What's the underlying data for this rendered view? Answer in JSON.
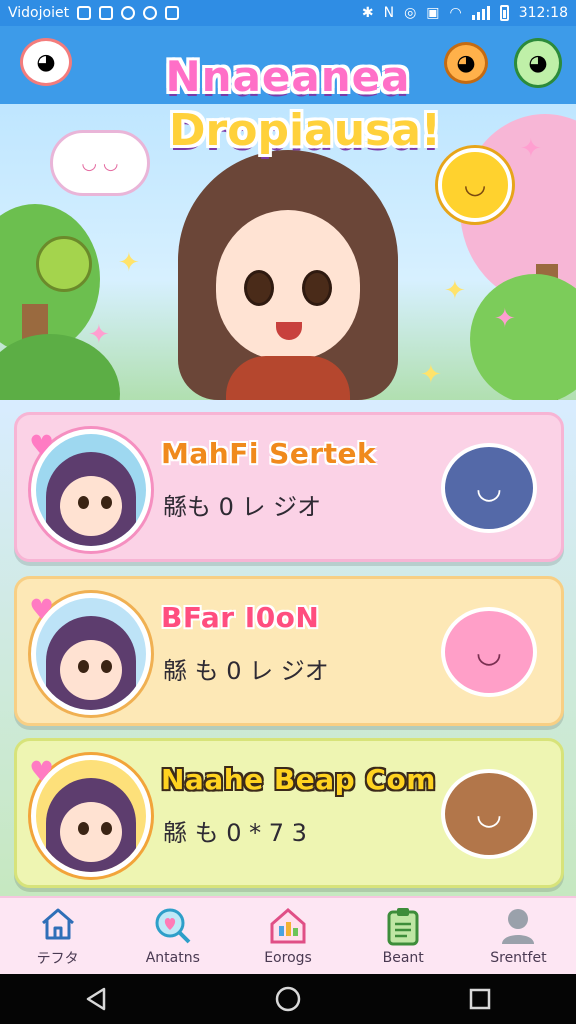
{
  "status_bar": {
    "app_label": "Vidojoiet",
    "time": "312:18"
  },
  "header": {
    "title_line_1": "Nnaeanea",
    "title_line_2": "Dropiausa!"
  },
  "cards": [
    {
      "name": "MahFi Sertek",
      "subtitle": "緜も 0 レ ジオ",
      "theme": "#fbd2e6"
    },
    {
      "name": "BFar I0oN",
      "subtitle": "緜 も 0 レ ジオ",
      "theme": "#fde8b6"
    },
    {
      "name": "Naahe Beap Com",
      "subtitle": "緜 も 0 * 7 3",
      "theme": "#eef5b2"
    }
  ],
  "bottom_nav": [
    {
      "label": "テフタ",
      "icon": "home-icon"
    },
    {
      "label": "Antatns",
      "icon": "heart-search-icon"
    },
    {
      "label": "Eorogs",
      "icon": "house-chart-icon"
    },
    {
      "label": "Beant",
      "icon": "clipboard-icon"
    },
    {
      "label": "Srentfet",
      "icon": "profile-icon"
    }
  ],
  "colors": {
    "status_bar": "#2f8de4",
    "header": "#3d9be9",
    "bottom_nav": "#fde6f3"
  }
}
